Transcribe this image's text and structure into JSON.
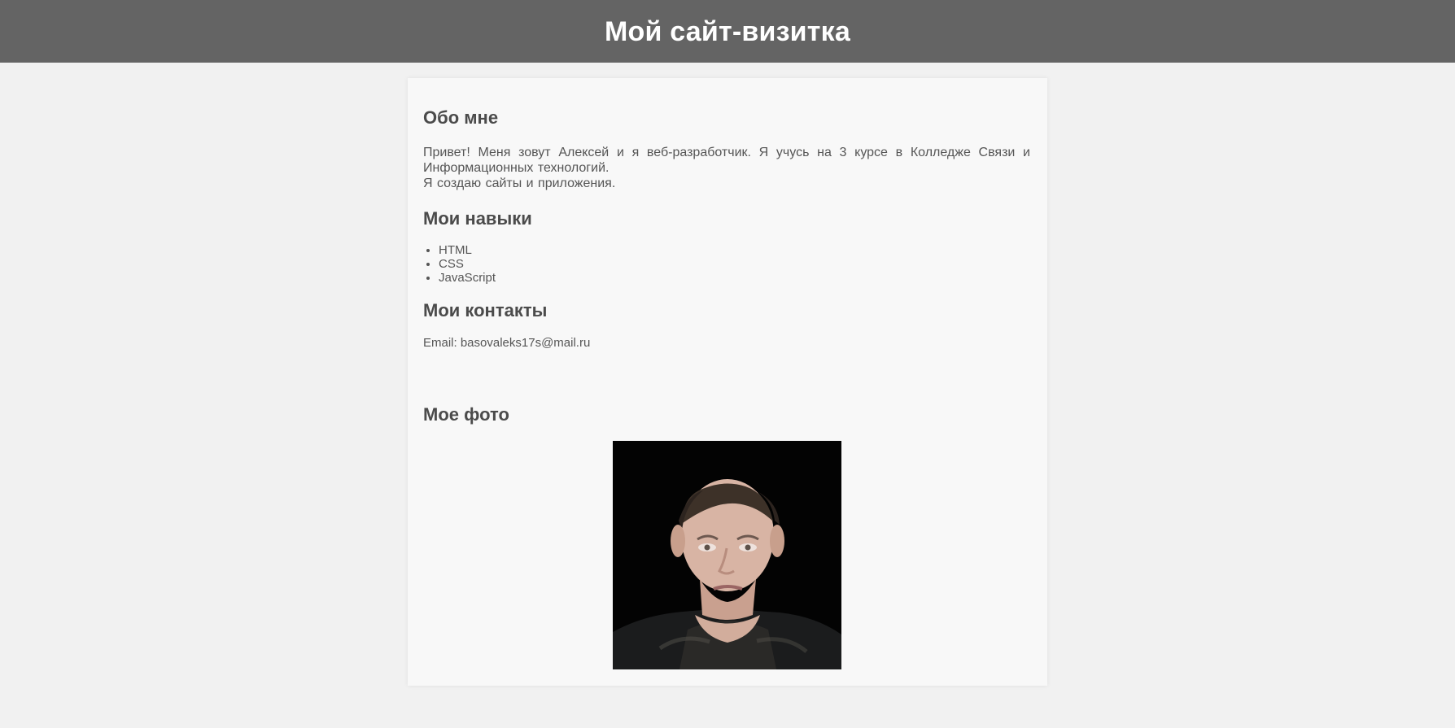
{
  "page": {
    "title": "Мой сайт-визитка"
  },
  "about": {
    "title": "Обо мне",
    "line1": "Привет! Меня зовут Алексей и я веб-разработчик. Я учусь на 3 курсе в Колледже Связи и Информационных технологий.",
    "line2": "Я создаю сайты и приложения."
  },
  "skills": {
    "title": "Мои навыки",
    "items": [
      "HTML",
      "CSS",
      "JavaScript"
    ]
  },
  "contacts": {
    "title": "Мои контакты",
    "email_line": "Email: basovaleks17s@mail.ru"
  },
  "photo": {
    "title": "Мое фото"
  },
  "colors": {
    "header_bg": "#646464",
    "page_bg": "#f1f1f1",
    "card_bg": "#f8f8f8",
    "text": "#555555"
  }
}
